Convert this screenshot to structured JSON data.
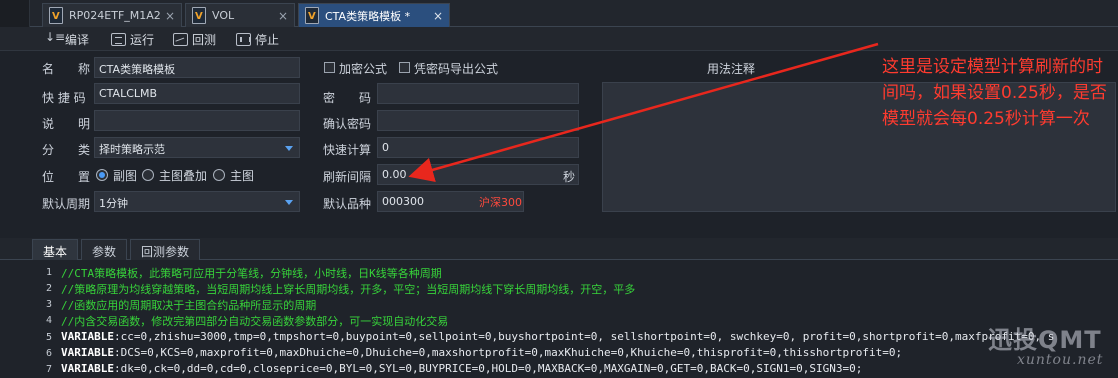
{
  "tabs": [
    {
      "label": "RP024ETF_M1A2",
      "close": "×"
    },
    {
      "label": "VOL",
      "close": "×"
    },
    {
      "label": "CTA类策略模板 *",
      "close": "×"
    }
  ],
  "toolbar": {
    "compile": "编译",
    "run": "运行",
    "backtest": "回测",
    "stop": "停止"
  },
  "form": {
    "name_label": "名　　称",
    "name_value": "CTA类策略模板",
    "shortcut_label": "快 捷 码",
    "shortcut_value": "CTALCLMB",
    "desc_label": "说　　明",
    "desc_value": "",
    "category_label": "分　　类",
    "category_value": "择时策略示范",
    "position_label": "位　　置",
    "position_options": [
      "副图",
      "主图叠加",
      "主图"
    ],
    "period_label": "默认周期",
    "period_value": "1分钟",
    "encrypt_label": "加密公式",
    "export_label": "凭密码导出公式",
    "password_label": "密　　码",
    "password_value": "",
    "confirm_label": "确认密码",
    "confirm_value": "",
    "quickcalc_label": "快速计算",
    "quickcalc_value": "0",
    "refresh_label": "刷新间隔",
    "refresh_value": "0.00",
    "refresh_unit": "秒",
    "default_code_label": "默认品种",
    "default_code_value": "000300",
    "default_code_name": "沪深300",
    "usage_label": "用法注释"
  },
  "bottom_tabs": [
    "基本",
    "参数",
    "回测参数"
  ],
  "code": [
    {
      "no": "1",
      "type": "comment",
      "text": "//CTA策略模板，此策略可应用于分笔线，分钟线，小时线，日K线等各种周期"
    },
    {
      "no": "2",
      "type": "comment",
      "text": "//策略原理为均线穿越策略，当短周期均线上穿长周期均线，开多，平空；当短周期均线下穿长周期均线，开空，平多"
    },
    {
      "no": "3",
      "type": "comment",
      "text": "//函数应用的周期取决于主图合约品种所显示的周期"
    },
    {
      "no": "4",
      "type": "comment",
      "text": "//内含交易函数，修改完第四部分自动交易函数参数部分，可一实现自动化交易"
    },
    {
      "no": "5",
      "type": "code",
      "kw": "VARIABLE",
      "text": ":cc=0,zhishu=3000,tmp=0,tmpshort=0,buypoint=0,sellpoint=0,buyshortpoint=0, sellshortpoint=0, swchkey=0, profit=0,shortprofit=0,maxfprofit=0, s"
    },
    {
      "no": "6",
      "type": "code",
      "kw": "VARIABLE",
      "text": ":DCS=0,KCS=0,maxprofit=0,maxDhuiche=0,Dhuiche=0,maxshortprofit=0,maxKhuiche=0,Khuiche=0,thisprofit=0,thisshortprofit=0;"
    },
    {
      "no": "7",
      "type": "code",
      "kw": "VARIABLE",
      "text": ":dk=0,ck=0,dd=0,cd=0,closeprice=0,BYL=0,SYL=0,BUYPRICE=0,HOLD=0,MAXBACK=0,MAXGAIN=0,GET=0,BACK=0,SIGN1=0,SIGN3=0;"
    }
  ],
  "annotation": "这里是设定模型计算刷新的时间吗，如果设置0.25秒，是否模型就会每0.25秒计算一次",
  "watermark": {
    "main": "迅投QMT",
    "sub": "xuntou.net"
  },
  "colors": {
    "comment": "#37d33a",
    "annotation": "#ff3b2f",
    "active_tab": "#2b4f7e",
    "code_red": "#ff4a3d"
  }
}
